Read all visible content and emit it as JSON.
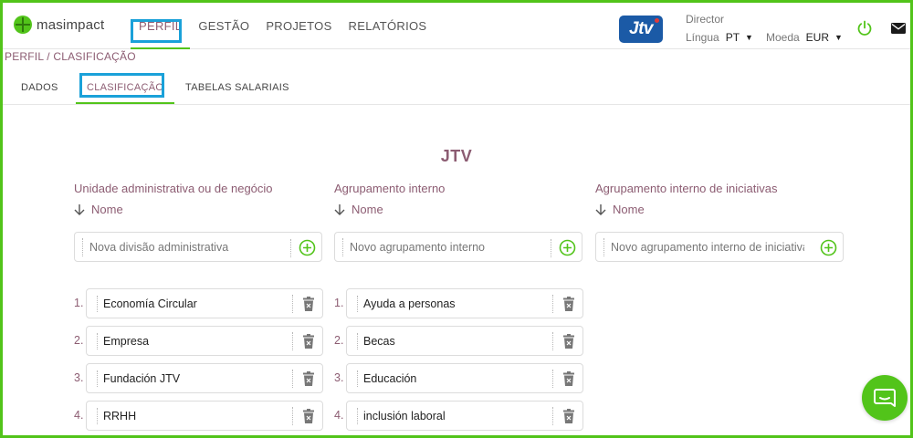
{
  "app": {
    "logo_text": "masimpact"
  },
  "nav": {
    "items": [
      {
        "label": "PERFIL"
      },
      {
        "label": "GESTÃO"
      },
      {
        "label": "PROJETOS"
      },
      {
        "label": "RELATÓRIOS"
      }
    ]
  },
  "header": {
    "brand": "Jtv",
    "user_role": "Director",
    "language_label": "Língua",
    "language_value": "PT",
    "currency_label": "Moeda",
    "currency_value": "EUR"
  },
  "breadcrumb": "PERFIL / CLASIFICAÇÃO",
  "subtabs": [
    {
      "label": "DADOS"
    },
    {
      "label": "CLASIFICAÇÃO"
    },
    {
      "label": "TABELAS SALARIAIS"
    }
  ],
  "company_name": "JTV",
  "columns": [
    {
      "title": "Unidade administrativa ou de negócio",
      "sort_label": "Nome",
      "placeholder": "Nova divisão administrativa",
      "items": [
        {
          "num": "1.",
          "label": "Economía Circular"
        },
        {
          "num": "2.",
          "label": "Empresa"
        },
        {
          "num": "3.",
          "label": "Fundación JTV"
        },
        {
          "num": "4.",
          "label": "RRHH"
        }
      ]
    },
    {
      "title": "Agrupamento interno",
      "sort_label": "Nome",
      "placeholder": "Novo agrupamento interno",
      "items": [
        {
          "num": "1.",
          "label": "Ayuda a personas"
        },
        {
          "num": "2.",
          "label": "Becas"
        },
        {
          "num": "3.",
          "label": "Educación"
        },
        {
          "num": "4.",
          "label": "inclusión laboral"
        }
      ]
    },
    {
      "title": "Agrupamento interno de iniciativas",
      "sort_label": "Nome",
      "placeholder": "Novo agrupamento interno de iniciativas",
      "items": []
    }
  ],
  "colors": {
    "accent": "#52c41a",
    "label": "#8c5c72",
    "highlight": "#1aa1d9",
    "brand": "#1b5aa6"
  }
}
